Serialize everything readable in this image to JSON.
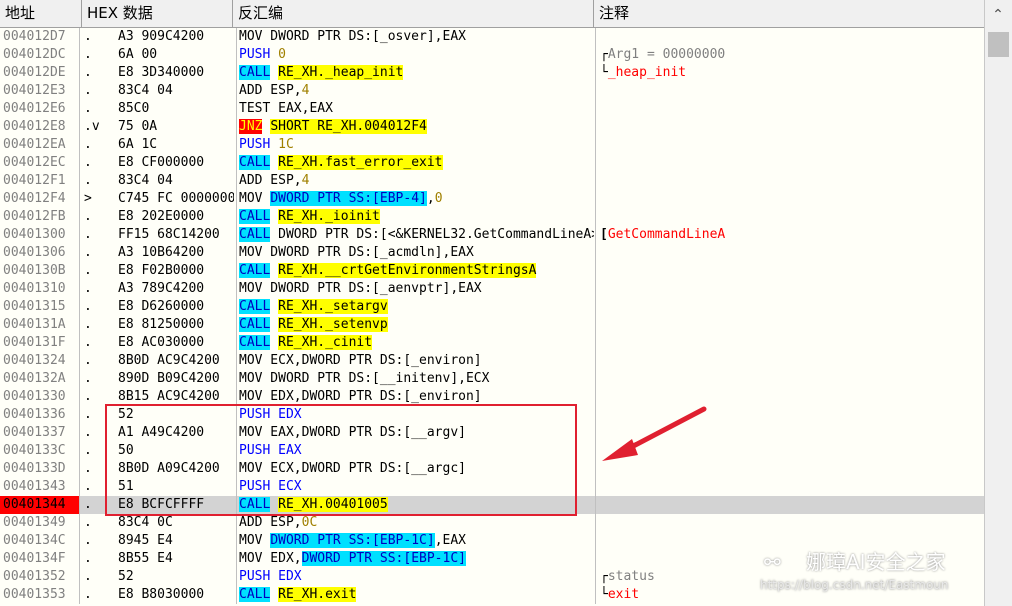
{
  "headers": {
    "address": "地址",
    "hex": "HEX 数据",
    "disasm": "反汇编",
    "comment": "注释"
  },
  "rows": [
    {
      "addr": "004012D7",
      "mark": ".",
      "hex": "A3 909C4200",
      "parts": [
        {
          "t": "MOV DWORD PTR DS:[_osver],EAX"
        }
      ],
      "cmt": []
    },
    {
      "addr": "004012DC",
      "mark": ".",
      "hex": "6A 00",
      "parts": [
        {
          "t": "PUSH",
          "c": "blue"
        },
        {
          "t": " "
        },
        {
          "t": "0",
          "c": "gold"
        }
      ],
      "cmt": [
        {
          "t": "Arg1 = 00000000",
          "c": "arg"
        }
      ],
      "br": "top"
    },
    {
      "addr": "004012DE",
      "mark": ".",
      "hex": "E8 3D340000",
      "parts": [
        {
          "t": "CALL",
          "c": "hl-cy"
        },
        {
          "t": " "
        },
        {
          "t": "RE_XH._heap_init",
          "c": "hl-ye"
        }
      ],
      "cmt": [
        {
          "t": "_heap_init",
          "c": "redtxt"
        }
      ],
      "br": "bot"
    },
    {
      "addr": "004012E3",
      "mark": ".",
      "hex": "83C4 04",
      "parts": [
        {
          "t": "ADD ESP,"
        },
        {
          "t": "4",
          "c": "gold"
        }
      ],
      "cmt": []
    },
    {
      "addr": "004012E6",
      "mark": ".",
      "hex": "85C0",
      "parts": [
        {
          "t": "TEST EAX,EAX"
        }
      ],
      "cmt": []
    },
    {
      "addr": "004012E8",
      "mark": ".v",
      "hex": "75 0A",
      "parts": [
        {
          "t": "JNZ",
          "c": "hl-red"
        },
        {
          "t": " "
        },
        {
          "t": "SHORT RE_XH.004012F4",
          "c": "hl-ye"
        }
      ],
      "cmt": []
    },
    {
      "addr": "004012EA",
      "mark": ".",
      "hex": "6A 1C",
      "parts": [
        {
          "t": "PUSH",
          "c": "blue"
        },
        {
          "t": " "
        },
        {
          "t": "1C",
          "c": "gold"
        }
      ],
      "cmt": []
    },
    {
      "addr": "004012EC",
      "mark": ".",
      "hex": "E8 CF000000",
      "parts": [
        {
          "t": "CALL",
          "c": "hl-cy"
        },
        {
          "t": " "
        },
        {
          "t": "RE_XH.fast_error_exit",
          "c": "hl-ye"
        }
      ],
      "cmt": []
    },
    {
      "addr": "004012F1",
      "mark": ".",
      "hex": "83C4 04",
      "parts": [
        {
          "t": "ADD ESP,"
        },
        {
          "t": "4",
          "c": "gold"
        }
      ],
      "cmt": []
    },
    {
      "addr": "004012F4",
      "mark": ">",
      "hex": "C745 FC 00000000",
      "parts": [
        {
          "t": "MOV "
        },
        {
          "t": "DWORD PTR SS:[EBP-4]",
          "c": "hl-cy"
        },
        {
          "t": ","
        },
        {
          "t": "0",
          "c": "gold"
        }
      ],
      "cmt": []
    },
    {
      "addr": "004012FB",
      "mark": ".",
      "hex": "E8 202E0000",
      "parts": [
        {
          "t": "CALL",
          "c": "hl-cy"
        },
        {
          "t": " "
        },
        {
          "t": "RE_XH._ioinit",
          "c": "hl-ye"
        }
      ],
      "cmt": []
    },
    {
      "addr": "00401300",
      "mark": ".",
      "hex": "FF15 68C14200",
      "parts": [
        {
          "t": "CALL",
          "c": "hl-cy"
        },
        {
          "t": " DWORD PTR DS:[<&KERNEL32.GetCommandLineA>]"
        }
      ],
      "cmt": [
        {
          "t": "GetCommandLineA",
          "c": "redtxt"
        }
      ],
      "br": "single"
    },
    {
      "addr": "00401306",
      "mark": ".",
      "hex": "A3 10B64200",
      "parts": [
        {
          "t": "MOV DWORD PTR DS:[_acmdln],EAX"
        }
      ],
      "cmt": []
    },
    {
      "addr": "0040130B",
      "mark": ".",
      "hex": "E8 F02B0000",
      "parts": [
        {
          "t": "CALL",
          "c": "hl-cy"
        },
        {
          "t": " "
        },
        {
          "t": "RE_XH.__crtGetEnvironmentStringsA",
          "c": "hl-ye"
        }
      ],
      "cmt": []
    },
    {
      "addr": "00401310",
      "mark": ".",
      "hex": "A3 789C4200",
      "parts": [
        {
          "t": "MOV DWORD PTR DS:[_aenvptr],EAX"
        }
      ],
      "cmt": []
    },
    {
      "addr": "00401315",
      "mark": ".",
      "hex": "E8 D6260000",
      "parts": [
        {
          "t": "CALL",
          "c": "hl-cy"
        },
        {
          "t": " "
        },
        {
          "t": "RE_XH._setargv",
          "c": "hl-ye"
        }
      ],
      "cmt": []
    },
    {
      "addr": "0040131A",
      "mark": ".",
      "hex": "E8 81250000",
      "parts": [
        {
          "t": "CALL",
          "c": "hl-cy"
        },
        {
          "t": " "
        },
        {
          "t": "RE_XH._setenvp",
          "c": "hl-ye"
        }
      ],
      "cmt": []
    },
    {
      "addr": "0040131F",
      "mark": ".",
      "hex": "E8 AC030000",
      "parts": [
        {
          "t": "CALL",
          "c": "hl-cy"
        },
        {
          "t": " "
        },
        {
          "t": "RE_XH._cinit",
          "c": "hl-ye"
        }
      ],
      "cmt": []
    },
    {
      "addr": "00401324",
      "mark": ".",
      "hex": "8B0D AC9C4200",
      "parts": [
        {
          "t": "MOV ECX,DWORD PTR DS:[_environ]"
        }
      ],
      "cmt": []
    },
    {
      "addr": "0040132A",
      "mark": ".",
      "hex": "890D B09C4200",
      "parts": [
        {
          "t": "MOV DWORD PTR DS:[__initenv],ECX"
        }
      ],
      "cmt": []
    },
    {
      "addr": "00401330",
      "mark": ".",
      "hex": "8B15 AC9C4200",
      "parts": [
        {
          "t": "MOV EDX,DWORD PTR DS:[_environ]"
        }
      ],
      "cmt": []
    },
    {
      "addr": "00401336",
      "mark": ".",
      "hex": "52",
      "parts": [
        {
          "t": "PUSH EDX",
          "c": "blue"
        }
      ],
      "cmt": []
    },
    {
      "addr": "00401337",
      "mark": ".",
      "hex": "A1 A49C4200",
      "parts": [
        {
          "t": "MOV EAX,DWORD PTR DS:[__argv]"
        }
      ],
      "cmt": []
    },
    {
      "addr": "0040133C",
      "mark": ".",
      "hex": "50",
      "parts": [
        {
          "t": "PUSH EAX",
          "c": "blue"
        }
      ],
      "cmt": []
    },
    {
      "addr": "0040133D",
      "mark": ".",
      "hex": "8B0D A09C4200",
      "parts": [
        {
          "t": "MOV ECX,DWORD PTR DS:[__argc]"
        }
      ],
      "cmt": []
    },
    {
      "addr": "00401343",
      "mark": ".",
      "hex": "51",
      "parts": [
        {
          "t": "PUSH ECX",
          "c": "blue"
        }
      ],
      "cmt": []
    },
    {
      "addr": "00401344",
      "mark": ".",
      "hex": "E8 BCFCFFFF",
      "parts": [
        {
          "t": "CALL",
          "c": "hl-cy"
        },
        {
          "t": " "
        },
        {
          "t": "RE_XH.00401005",
          "c": "hl-ye"
        }
      ],
      "cmt": [],
      "sel": true
    },
    {
      "addr": "00401349",
      "mark": ".",
      "hex": "83C4 0C",
      "parts": [
        {
          "t": "ADD ESP,"
        },
        {
          "t": "0C",
          "c": "gold"
        }
      ],
      "cmt": []
    },
    {
      "addr": "0040134C",
      "mark": ".",
      "hex": "8945 E4",
      "parts": [
        {
          "t": "MOV "
        },
        {
          "t": "DWORD PTR SS:[EBP-1C]",
          "c": "hl-cy"
        },
        {
          "t": ",EAX"
        }
      ],
      "cmt": []
    },
    {
      "addr": "0040134F",
      "mark": ".",
      "hex": "8B55 E4",
      "parts": [
        {
          "t": "MOV EDX,"
        },
        {
          "t": "DWORD PTR SS:[EBP-1C]",
          "c": "hl-cy"
        }
      ],
      "cmt": []
    },
    {
      "addr": "00401352",
      "mark": ".",
      "hex": "52",
      "parts": [
        {
          "t": "PUSH EDX",
          "c": "blue"
        }
      ],
      "cmt": [
        {
          "t": "status",
          "c": "arg"
        }
      ],
      "br": "top"
    },
    {
      "addr": "00401353",
      "mark": ".",
      "hex": "E8 B8030000",
      "parts": [
        {
          "t": "CALL",
          "c": "hl-cy"
        },
        {
          "t": " "
        },
        {
          "t": "RE_XH.exit",
          "c": "hl-ye"
        }
      ],
      "cmt": [
        {
          "t": "exit",
          "c": "redtxt"
        }
      ],
      "br": "bot"
    }
  ],
  "watermark": {
    "brand": "娜璋AI安全之家",
    "url": "https://blog.csdn.net/Eastmoun",
    "icon": "wechat-icon"
  },
  "colors": {
    "selected_addr": "#ff0000",
    "call_bg": "#00e0ff",
    "label_bg": "#ffff00",
    "annotation_box": "#e02030"
  }
}
